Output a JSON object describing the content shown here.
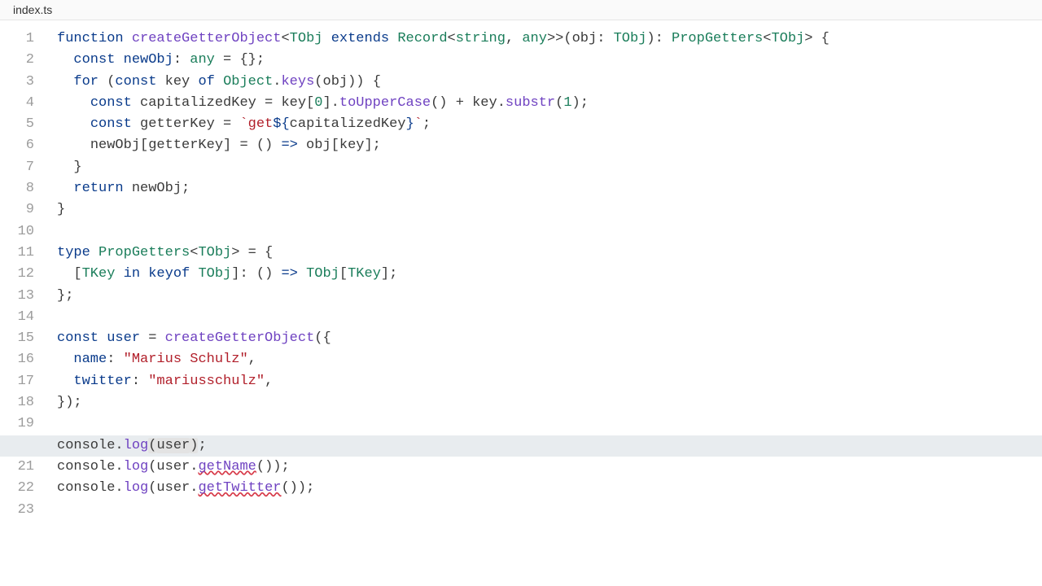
{
  "tab": {
    "filename": "index.ts"
  },
  "editor": {
    "active_line": 20,
    "line_count": 23,
    "tokens": {
      "l1": {
        "function": "function",
        "fname": "createGetterObject",
        "lt1": "<",
        "tobj1": "TObj",
        "extends": "extends",
        "record": "Record",
        "lt2": "<",
        "string": "string",
        "comma1": ", ",
        "any1": "any",
        "gt2": ">>",
        "lp": "(",
        "obj": "obj",
        "colon": ": ",
        "tobj2": "TObj",
        "rp": ")",
        "colon2": ": ",
        "pg": "PropGetters",
        "lt3": "<",
        "tobj3": "TObj",
        "gt3": ">",
        "brace": " {"
      },
      "l2": {
        "const": "const",
        "newobj": "newObj",
        "colon": ": ",
        "any": "any",
        "eq": " = {};"
      },
      "l3": {
        "for": "for",
        "lp": " (",
        "const": "const",
        "key": " key ",
        "of": "of",
        "sp": " ",
        "Object": "Object",
        "dot": ".",
        "keys": "keys",
        "args": "(obj)) {"
      },
      "l4": {
        "const": "const",
        "cap": " capitalizedKey = key[",
        "zero": "0",
        "rb": "].",
        "toU": "toUpperCase",
        "p1": "() + key.",
        "substr": "substr",
        "lp2": "(",
        "one": "1",
        "rp2": ");"
      },
      "l5": {
        "const": "const",
        "gk": " getterKey = ",
        "bt1": "`",
        "get": "get",
        "dlr": "${",
        "ck": "capitalizedKey",
        "rbr": "}",
        "bt2": "`",
        "semi": ";"
      },
      "l6": {
        "txt1": "newObj[getterKey] = () ",
        "arrow": "=>",
        "txt2": " obj[key];"
      },
      "l7": {
        "brace": "}"
      },
      "l8": {
        "return": "return",
        "newobj": " newObj;"
      },
      "l9": {
        "brace": "}"
      },
      "l11": {
        "type": "type",
        "pg": "PropGetters",
        "lt": "<",
        "tobj": "TObj",
        "gt": ">",
        "eq": " = {"
      },
      "l12": {
        "lb": "[",
        "tkey": "TKey",
        "in": "in",
        "keyof": "keyof",
        "tobj": "TObj",
        "rb": "]: () ",
        "arrow": "=>",
        "sp": " ",
        "tobj2": "TObj",
        "lb2": "[",
        "tkey2": "TKey",
        "rb2": "];"
      },
      "l13": {
        "brace": "};"
      },
      "l15": {
        "const": "const",
        "user": "user",
        "eq": " = ",
        "fn": "createGetterObject",
        "arg": "({"
      },
      "l16": {
        "name": "name",
        "colon": ": ",
        "val": "\"Marius Schulz\"",
        "comma": ","
      },
      "l17": {
        "twitter": "twitter",
        "colon": ": ",
        "val": "\"mariusschulz\"",
        "comma": ","
      },
      "l18": {
        "brace": "});"
      },
      "l20": {
        "console": "console",
        "dot": ".",
        "log": "log",
        "lp": "(",
        "user": "user",
        "rp": ")",
        "semi": ";"
      },
      "l21": {
        "console": "console",
        "dot": ".",
        "log": "log",
        "lp": "(user.",
        "getName": "getName",
        "rp": "());"
      },
      "l22": {
        "console": "console",
        "dot": ".",
        "log": "log",
        "lp": "(user.",
        "getTwitter": "getTwitter",
        "rp": "());"
      }
    }
  }
}
